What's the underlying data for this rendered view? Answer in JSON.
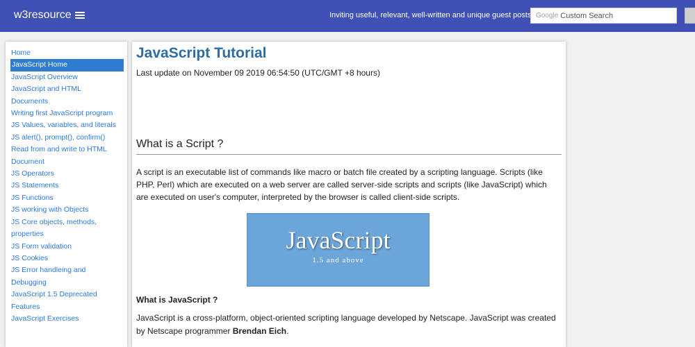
{
  "header": {
    "brand": "w3resource",
    "tagline": "Inviting useful, relevant, well-written and unique guest posts.",
    "search_brand": "Google",
    "search_placeholder": "Custom Search"
  },
  "sidebar": {
    "items": [
      {
        "label": "Home"
      },
      {
        "label": "JavaScript Home",
        "active": true
      },
      {
        "label": "JavaScript Overview"
      },
      {
        "label": "JavaScript and HTML Documents"
      },
      {
        "label": "Writing first JavaScript program"
      },
      {
        "label": "JS Values, variables, and literals"
      },
      {
        "label": "JS alert(), prompt(), confirm()"
      },
      {
        "label": "Read from and write to HTML"
      },
      {
        "label": "Document"
      },
      {
        "label": "JS Operators"
      },
      {
        "label": "JS Statements"
      },
      {
        "label": "JS Functions"
      },
      {
        "label": "JS working with Objects"
      },
      {
        "label": "JS Core objects, methods,"
      },
      {
        "label": "properties"
      },
      {
        "label": "JS Form validation"
      },
      {
        "label": "JS Cookies"
      },
      {
        "label": "JS Error handleing and Debugging"
      },
      {
        "label": "JavaScript 1.5 Deprecated Features"
      },
      {
        "label": "JavaScript Exercises"
      }
    ]
  },
  "main": {
    "title": "JavaScript Tutorial",
    "updated": "Last update on November 09 2019 06:54:50 (UTC/GMT +8 hours)",
    "section_heading": "What is a Script ?",
    "paragraph1": "A script is an executable list of commands like macro or batch file created by a scripting language. Scripts (like PHP, Perl) which are executed on a web server are called server-side scripts and scripts (like JavaScript) which are executed on user's computer, interpreted by the browser is called client-side scripts.",
    "banner_title": "JavaScript",
    "banner_subtitle": "1.5 and above",
    "sub_heading": "What is JavaScript ?",
    "paragraph2_start": "JavaScript is a cross-platform, object-oriented scripting language developed by Netscape. JavaScript was created by Netscape programmer ",
    "paragraph2_bold": "Brendan Eich",
    "paragraph2_end": "."
  },
  "colors": {
    "header_bg": "#3f51b5",
    "link": "#2a7ae2",
    "active_item_bg": "#2e7dd1",
    "title": "#2e6da4",
    "banner_bg": "#6ba5d9"
  }
}
